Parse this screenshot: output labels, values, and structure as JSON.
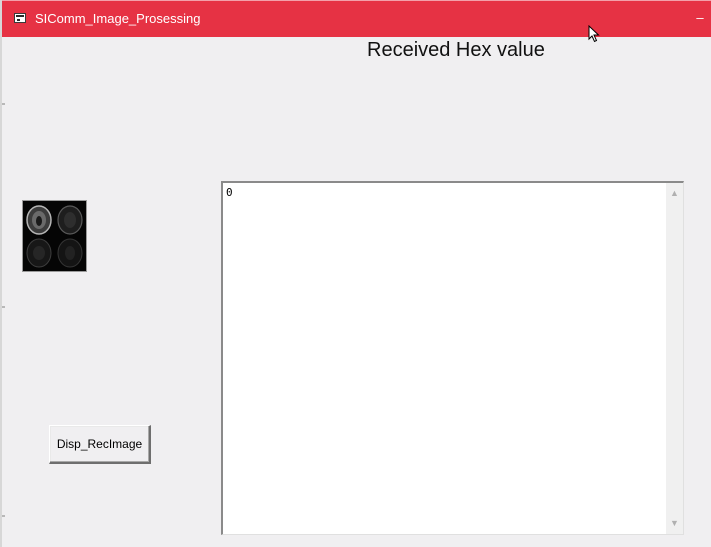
{
  "window": {
    "title": "SIComm_Image_Prosessing",
    "minimize_glyph": "–"
  },
  "main": {
    "heading": "Received Hex value",
    "textbox_value": "0",
    "button_label": "Disp_RecImage"
  },
  "scrollbar": {
    "up_glyph": "▲",
    "down_glyph": "▼"
  },
  "colors": {
    "titlebar": "#e63244",
    "window_bg": "#f0eff1",
    "textbox_bg": "#ffffff"
  },
  "icons": {
    "app": "window-app-icon",
    "cursor": "mouse-pointer-icon",
    "image": "mri-brain-scan-thumbnail"
  }
}
